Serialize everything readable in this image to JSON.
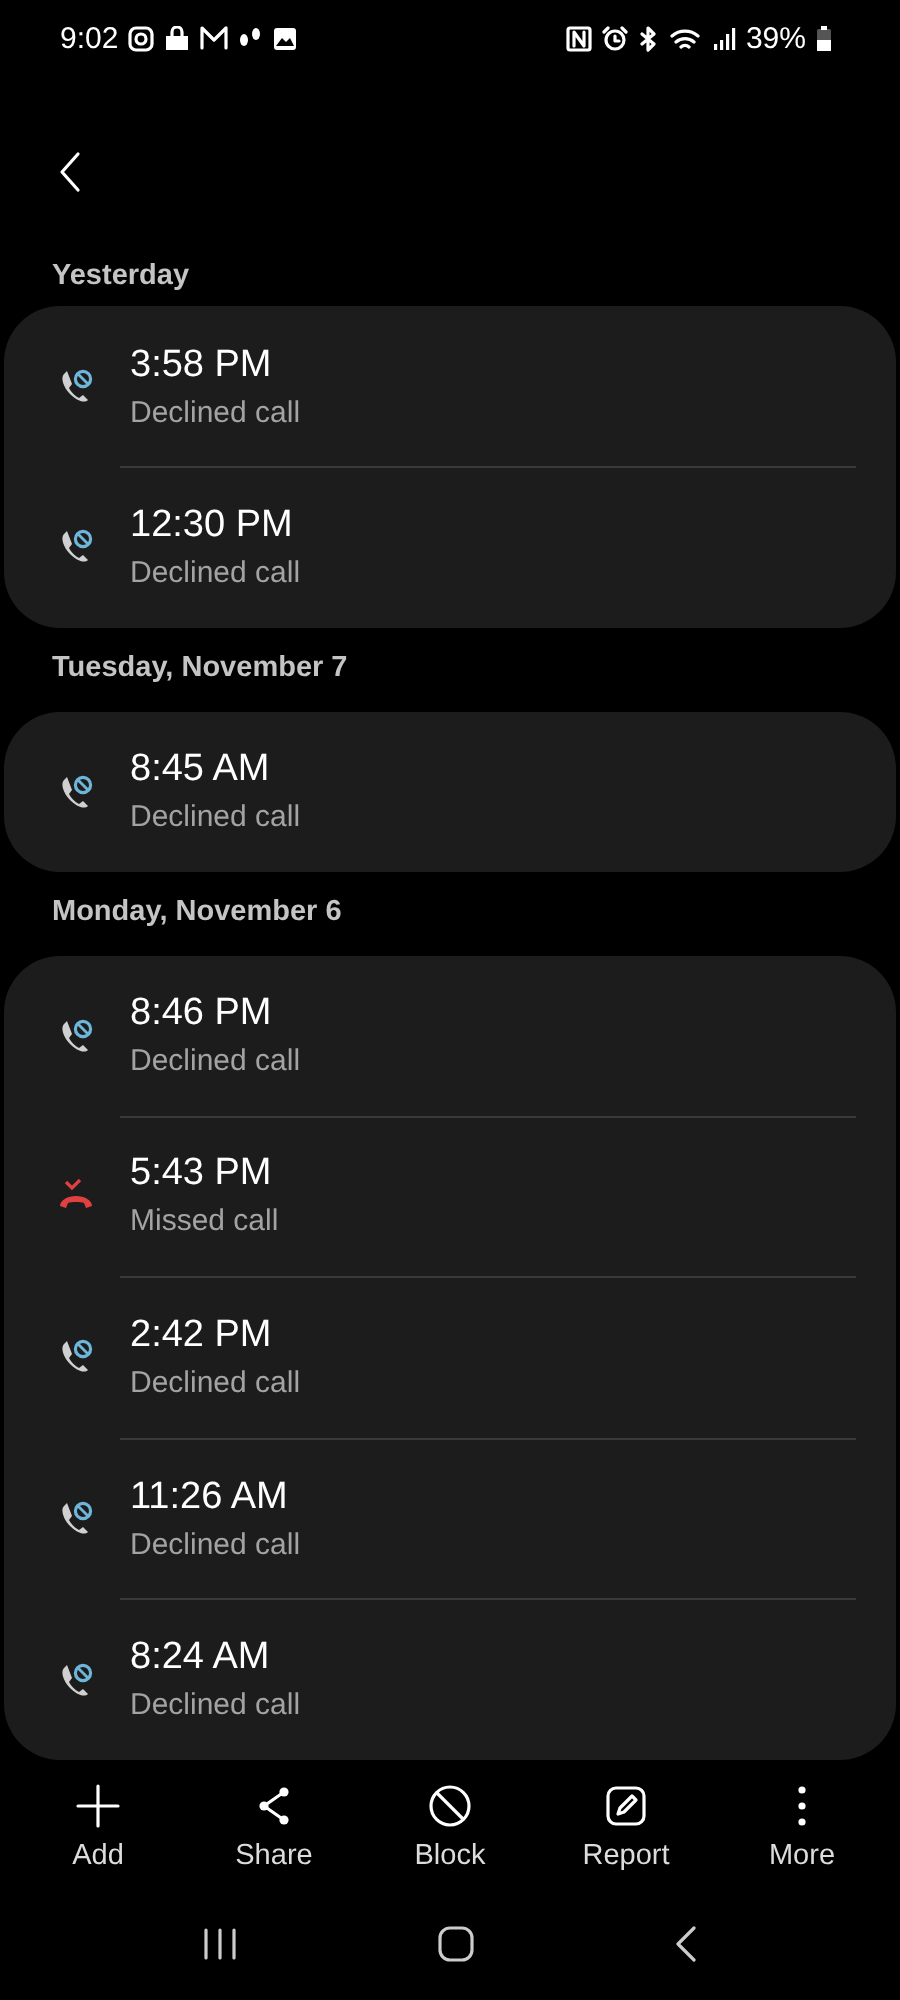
{
  "status_bar": {
    "time": "9:02",
    "battery": "39%"
  },
  "groups": [
    {
      "date": "Yesterday",
      "calls": [
        {
          "time": "3:58 PM",
          "label": "Declined call",
          "kind": "declined"
        },
        {
          "time": "12:30 PM",
          "label": "Declined call",
          "kind": "declined"
        }
      ]
    },
    {
      "date": "Tuesday, November 7",
      "calls": [
        {
          "time": "8:45 AM",
          "label": "Declined call",
          "kind": "declined"
        }
      ]
    },
    {
      "date": "Monday, November 6",
      "calls": [
        {
          "time": "8:46 PM",
          "label": "Declined call",
          "kind": "declined"
        },
        {
          "time": "5:43 PM",
          "label": "Missed call",
          "kind": "missed"
        },
        {
          "time": "2:42 PM",
          "label": "Declined call",
          "kind": "declined"
        },
        {
          "time": "11:26 AM",
          "label": "Declined call",
          "kind": "declined"
        },
        {
          "time": "8:24 AM",
          "label": "Declined call",
          "kind": "declined"
        }
      ]
    }
  ],
  "actions": [
    {
      "label": "Add",
      "kind": "add"
    },
    {
      "label": "Share",
      "kind": "share"
    },
    {
      "label": "Block",
      "kind": "block"
    },
    {
      "label": "Report",
      "kind": "report"
    },
    {
      "label": "More",
      "kind": "more"
    }
  ]
}
